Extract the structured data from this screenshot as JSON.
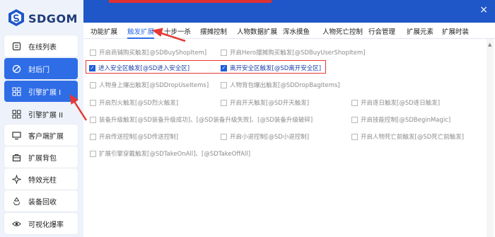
{
  "app": {
    "title": "SDGOM"
  },
  "sidebar": {
    "items": [
      {
        "label": "在线列表",
        "icon": "list-icon"
      },
      {
        "label": "封后门",
        "icon": "block-icon"
      },
      {
        "label": "引擎扩展 I",
        "icon": "grid-icon"
      },
      {
        "label": "引擎扩展 II",
        "icon": "grid-icon"
      },
      {
        "label": "客户端扩展",
        "icon": "monitor-icon"
      },
      {
        "label": "扩展背包",
        "icon": "bag-icon"
      },
      {
        "label": "特效光柱",
        "icon": "sparkle-icon"
      },
      {
        "label": "装备回收",
        "icon": "recycle-icon"
      },
      {
        "label": "可视化爆率",
        "icon": "eye-icon"
      }
    ]
  },
  "tabs": [
    "功能扩展",
    "触发扩展",
    "十步一杀",
    "摆摊控制",
    "人物数据扩展",
    "浑水摸鱼",
    "人物死亡控制",
    "行会管理",
    "扩展元素",
    "扩展时装"
  ],
  "triggers": [
    {
      "label": "开启商铺购买触发[@SDBuyShopItem]",
      "checked": false
    },
    {
      "label": "开启Hero摆摊购买触发[@SDBuyUserShopItem]",
      "checked": false
    },
    {
      "label": "进入安全区触发[@SD进入安全区]",
      "checked": true
    },
    {
      "label": "离开安全区触发[@SD离开安全区]",
      "checked": true
    },
    {
      "label": "人物身上爆出触发[@SDDropUseItems]",
      "checked": false
    },
    {
      "label": "人物背包爆出触发[@SDDropBagItems]",
      "checked": false
    },
    {
      "label": "开启烈火触发[@SD烈火触发]",
      "checked": false
    },
    {
      "label": "开启开天触发[@SD开天触发]",
      "checked": false
    },
    {
      "label": "开启逐日触发[@SD逐日触发]",
      "checked": false
    },
    {
      "label": "装备升级触发[@SD装备升级成功]、[@SD装备升级失败]、[@SD装备升级破碎]",
      "checked": false
    },
    {
      "label": "开启技能控制[@SDBeginMagic]",
      "checked": false
    },
    {
      "label": "开启传送控制[@SD传送控制]",
      "checked": false
    },
    {
      "label": "开启小退控制[@SD小退控制]",
      "checked": false
    },
    {
      "label": "开启人物死亡前触发[@SD死亡前触发]",
      "checked": false
    },
    {
      "label": "扩展引擎穿戴触发[@SDTakeOnAll]、[@SDTakeOffAll]",
      "checked": false
    }
  ],
  "colors": {
    "accent": "#2f6de6",
    "highlight": "#e53935",
    "brand": "#1e3a78"
  }
}
